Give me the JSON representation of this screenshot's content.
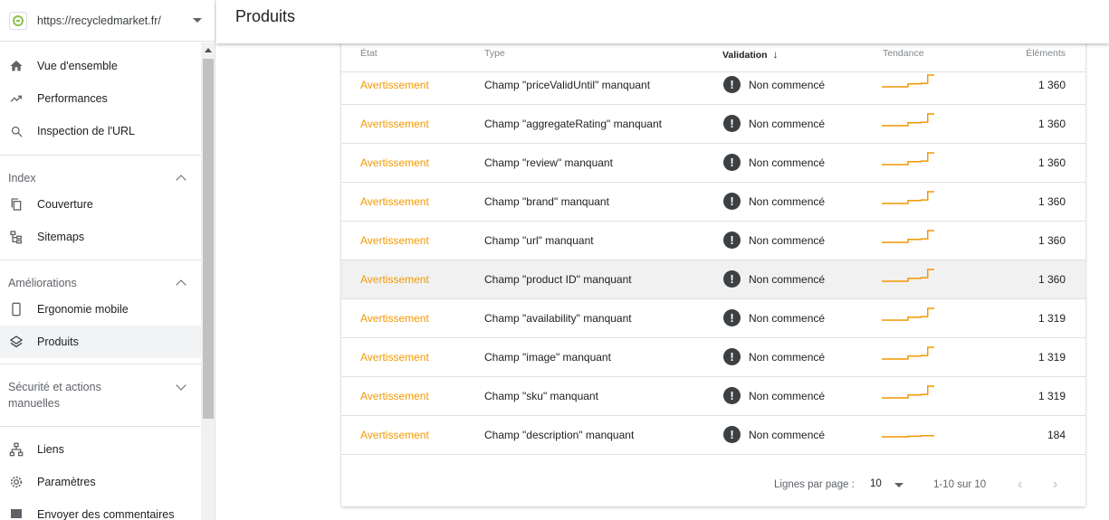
{
  "property": {
    "url": "https://recycledmarket.fr/"
  },
  "nav": {
    "top": [
      {
        "label": "Vue d'ensemble",
        "icon": "home-icon"
      },
      {
        "label": "Performances",
        "icon": "trending-icon"
      },
      {
        "label": "Inspection de l'URL",
        "icon": "search-icon"
      }
    ],
    "index": {
      "title": "Index",
      "items": [
        {
          "label": "Couverture",
          "icon": "copy-icon"
        },
        {
          "label": "Sitemaps",
          "icon": "sitemap-icon"
        }
      ]
    },
    "ameliorations": {
      "title": "Améliorations",
      "items": [
        {
          "label": "Ergonomie mobile",
          "icon": "phone-icon"
        },
        {
          "label": "Produits",
          "icon": "layers-icon"
        }
      ]
    },
    "securite": {
      "title": "Sécurité et actions manuelles"
    },
    "bottom": [
      {
        "label": "Liens",
        "icon": "links-icon"
      },
      {
        "label": "Paramètres",
        "icon": "settings-icon"
      },
      {
        "label": "Envoyer des commentaires",
        "icon": "feedback-icon"
      }
    ]
  },
  "header": {
    "title": "Produits"
  },
  "table": {
    "columns": {
      "state": "État",
      "type": "Type",
      "validation": "Validation",
      "trend": "Tendance",
      "count": "Éléments"
    },
    "sort_arrow": "↓",
    "rows": [
      {
        "state": "Avertissement",
        "type": "Champ \"priceValidUntil\" manquant",
        "validation": "Non commencé",
        "count": "1 360",
        "trend": [
          0,
          0,
          0,
          0,
          0.25,
          0.25,
          0.3,
          1,
          1
        ]
      },
      {
        "state": "Avertissement",
        "type": "Champ \"aggregateRating\" manquant",
        "validation": "Non commencé",
        "count": "1 360",
        "trend": [
          0,
          0,
          0,
          0,
          0.25,
          0.25,
          0.3,
          1,
          1
        ]
      },
      {
        "state": "Avertissement",
        "type": "Champ \"review\" manquant",
        "validation": "Non commencé",
        "count": "1 360",
        "trend": [
          0,
          0,
          0,
          0,
          0.25,
          0.25,
          0.3,
          1,
          1
        ]
      },
      {
        "state": "Avertissement",
        "type": "Champ \"brand\" manquant",
        "validation": "Non commencé",
        "count": "1 360",
        "trend": [
          0,
          0,
          0,
          0,
          0.25,
          0.25,
          0.3,
          1,
          1
        ]
      },
      {
        "state": "Avertissement",
        "type": "Champ \"url\" manquant",
        "validation": "Non commencé",
        "count": "1 360",
        "trend": [
          0,
          0,
          0,
          0,
          0.25,
          0.25,
          0.3,
          1,
          1
        ]
      },
      {
        "state": "Avertissement",
        "type": "Champ \"product ID\" manquant",
        "validation": "Non commencé",
        "count": "1 360",
        "trend": [
          0,
          0,
          0,
          0,
          0.25,
          0.25,
          0.3,
          1,
          1
        ]
      },
      {
        "state": "Avertissement",
        "type": "Champ \"availability\" manquant",
        "validation": "Non commencé",
        "count": "1 319",
        "trend": [
          0,
          0,
          0,
          0,
          0.25,
          0.25,
          0.3,
          1,
          1
        ]
      },
      {
        "state": "Avertissement",
        "type": "Champ \"image\" manquant",
        "validation": "Non commencé",
        "count": "1 319",
        "trend": [
          0,
          0,
          0,
          0,
          0.25,
          0.25,
          0.3,
          1,
          1
        ]
      },
      {
        "state": "Avertissement",
        "type": "Champ \"sku\" manquant",
        "validation": "Non commencé",
        "count": "1 319",
        "trend": [
          0,
          0,
          0,
          0,
          0.25,
          0.25,
          0.3,
          1,
          1
        ]
      },
      {
        "state": "Avertissement",
        "type": "Champ \"description\" manquant",
        "validation": "Non commencé",
        "count": "184",
        "trend": [
          0,
          0,
          0,
          0,
          0.05,
          0.05,
          0.1,
          0.1,
          0.1
        ]
      }
    ],
    "highlighted_row": 5
  },
  "pager": {
    "rows_label": "Lignes par page :",
    "rows_value": "10",
    "range": "1-10 sur 10",
    "prev": "‹",
    "next": "›"
  },
  "colors": {
    "warning": "#f29900",
    "trend_line": "#f29900"
  }
}
